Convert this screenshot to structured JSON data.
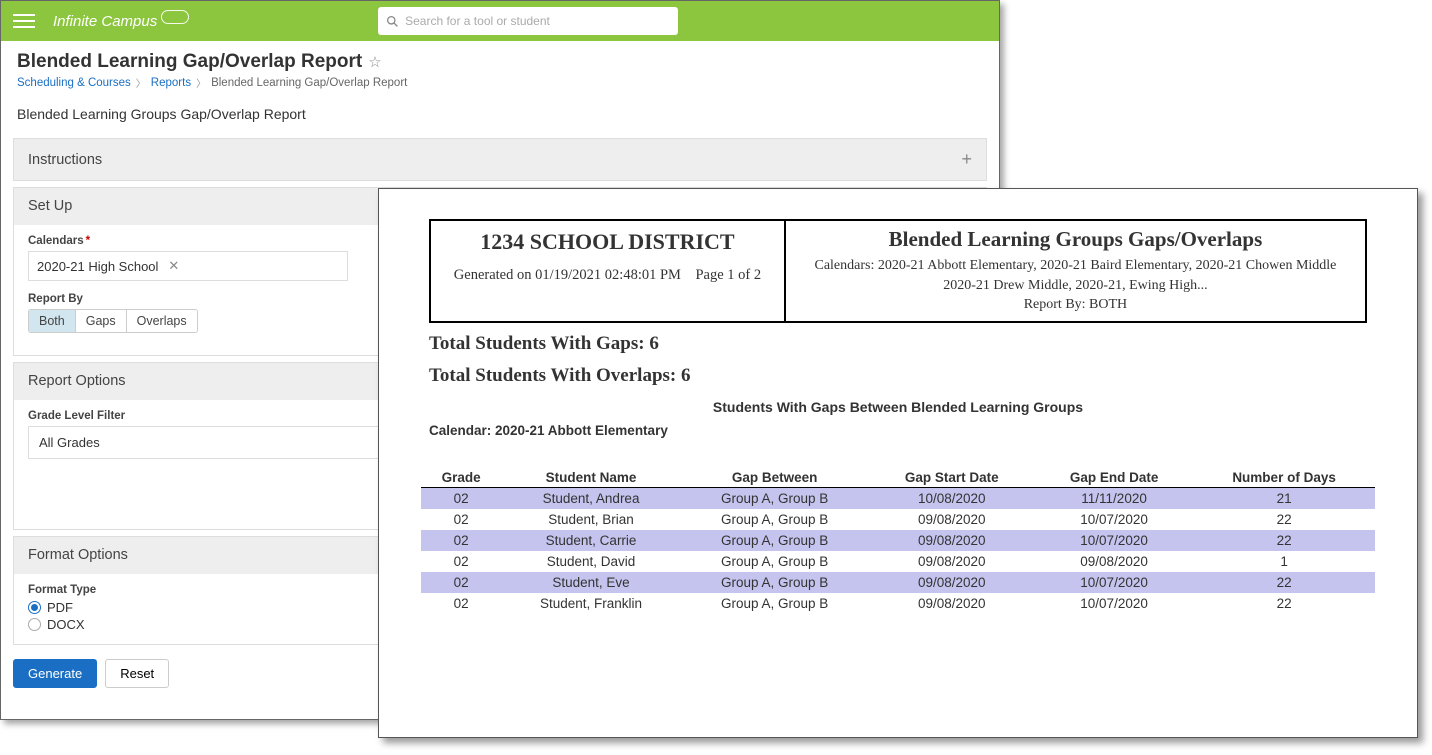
{
  "top": {
    "logo_text": "Infinite Campus",
    "search_placeholder": "Search for a tool or student"
  },
  "page": {
    "title": "Blended Learning Gap/Overlap Report",
    "breadcrumb": {
      "a": "Scheduling & Courses",
      "b": "Reports",
      "c": "Blended Learning Gap/Overlap Report"
    },
    "subtitle": "Blended Learning Groups Gap/Overlap Report"
  },
  "panels": {
    "instructions_title": "Instructions",
    "setup_title": "Set Up",
    "options_title": "Report Options",
    "format_title": "Format Options"
  },
  "setup": {
    "calendars_label": "Calendars",
    "calendar_value": "2020-21 High School",
    "report_by_label": "Report By",
    "seg_both": "Both",
    "seg_gaps": "Gaps",
    "seg_overlaps": "Overlaps"
  },
  "options": {
    "grade_label": "Grade Level Filter",
    "grade_value": "All Grades"
  },
  "format": {
    "type_label": "Format Type",
    "pdf": "PDF",
    "docx": "DOCX"
  },
  "buttons": {
    "generate": "Generate",
    "reset": "Reset"
  },
  "report": {
    "district": "1234 SCHOOL DISTRICT",
    "generated": "Generated on 01/19/2021 02:48:01 PM",
    "page": "Page 1 of  2",
    "title": "Blended Learning Groups Gaps/Overlaps",
    "calendars": "Calendars: 2020-21 Abbott Elementary, 2020-21 Baird Elementary, 2020-21 Chowen Middle",
    "calendars2": "2020-21 Drew Middle, 2020-21, Ewing High...",
    "report_by": "Report By: BOTH",
    "total_gaps": "Total Students With Gaps:  6",
    "total_overlaps": "Total Students With Overlaps:  6",
    "section_title": "Students With Gaps Between Blended Learning Groups",
    "calendar_line": "Calendar: 2020-21 Abbott Elementary",
    "headers": {
      "grade": "Grade",
      "name": "Student Name",
      "between": "Gap Between",
      "start": "Gap Start Date",
      "end": "Gap End Date",
      "days": "Number of Days"
    }
  },
  "chart_data": {
    "type": "table",
    "title": "Students With Gaps Between Blended Learning Groups",
    "columns": [
      "Grade",
      "Student Name",
      "Gap Between",
      "Gap Start Date",
      "Gap End Date",
      "Number of Days"
    ],
    "rows": [
      {
        "grade": "02",
        "name": "Student, Andrea",
        "between": "Group A, Group B",
        "start": "10/08/2020",
        "end": "11/11/2020",
        "days": "21"
      },
      {
        "grade": "02",
        "name": "Student, Brian",
        "between": "Group A, Group B",
        "start": "09/08/2020",
        "end": "10/07/2020",
        "days": "22"
      },
      {
        "grade": "02",
        "name": "Student, Carrie",
        "between": "Group A, Group B",
        "start": "09/08/2020",
        "end": "10/07/2020",
        "days": "22"
      },
      {
        "grade": "02",
        "name": "Student, David",
        "between": "Group A, Group B",
        "start": "09/08/2020",
        "end": "09/08/2020",
        "days": "1"
      },
      {
        "grade": "02",
        "name": "Student, Eve",
        "between": "Group A, Group B",
        "start": "09/08/2020",
        "end": "10/07/2020",
        "days": "22"
      },
      {
        "grade": "02",
        "name": "Student, Franklin",
        "between": "Group A, Group B",
        "start": "09/08/2020",
        "end": "10/07/2020",
        "days": "22"
      }
    ]
  }
}
